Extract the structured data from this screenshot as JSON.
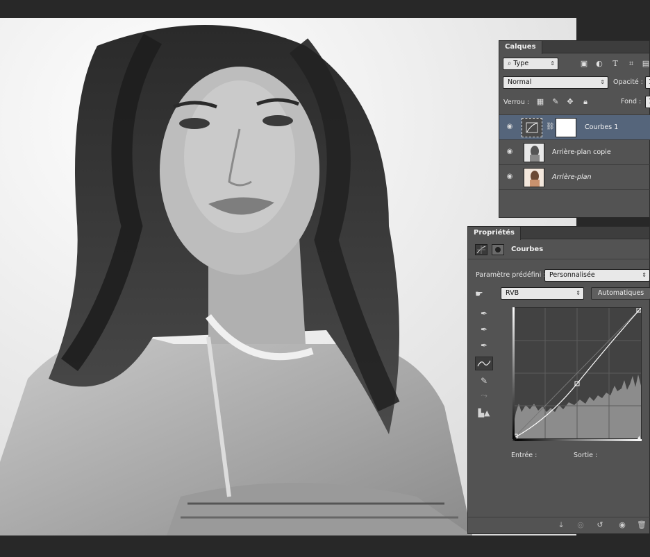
{
  "layers_panel": {
    "tab": "Calques",
    "filter": "Type",
    "blend_mode": "Normal",
    "opacity_label": "Opacité :",
    "opacity_value": "1",
    "lock_label": "Verrou :",
    "fill_label": "Fond :",
    "fill_value": "1",
    "layers": [
      {
        "name": "Courbes 1",
        "selected": true,
        "italic": false
      },
      {
        "name": "Arrière-plan copie",
        "selected": false,
        "italic": false
      },
      {
        "name": "Arrière-plan",
        "selected": false,
        "italic": true
      }
    ],
    "filter_icons": [
      "image-filter-icon",
      "adjustment-filter-icon",
      "type-filter-icon",
      "shape-filter-icon",
      "smart-object-filter-icon"
    ]
  },
  "properties_panel": {
    "tab": "Propriétés",
    "title": "Courbes",
    "preset_label": "Paramètre prédéfini :",
    "preset_value": "Personnalisée",
    "channel": "RVB",
    "auto_button": "Automatiques",
    "input_label": "Entrée :",
    "output_label": "Sortie :",
    "curve_points": [
      [
        0,
        0
      ],
      [
        0.5,
        0.42
      ],
      [
        1,
        1
      ]
    ]
  },
  "colors": {
    "app_bg": "#282828",
    "panel_bg": "#535353",
    "selected_layer": "#55657b",
    "curve_line": "#ffffff"
  }
}
